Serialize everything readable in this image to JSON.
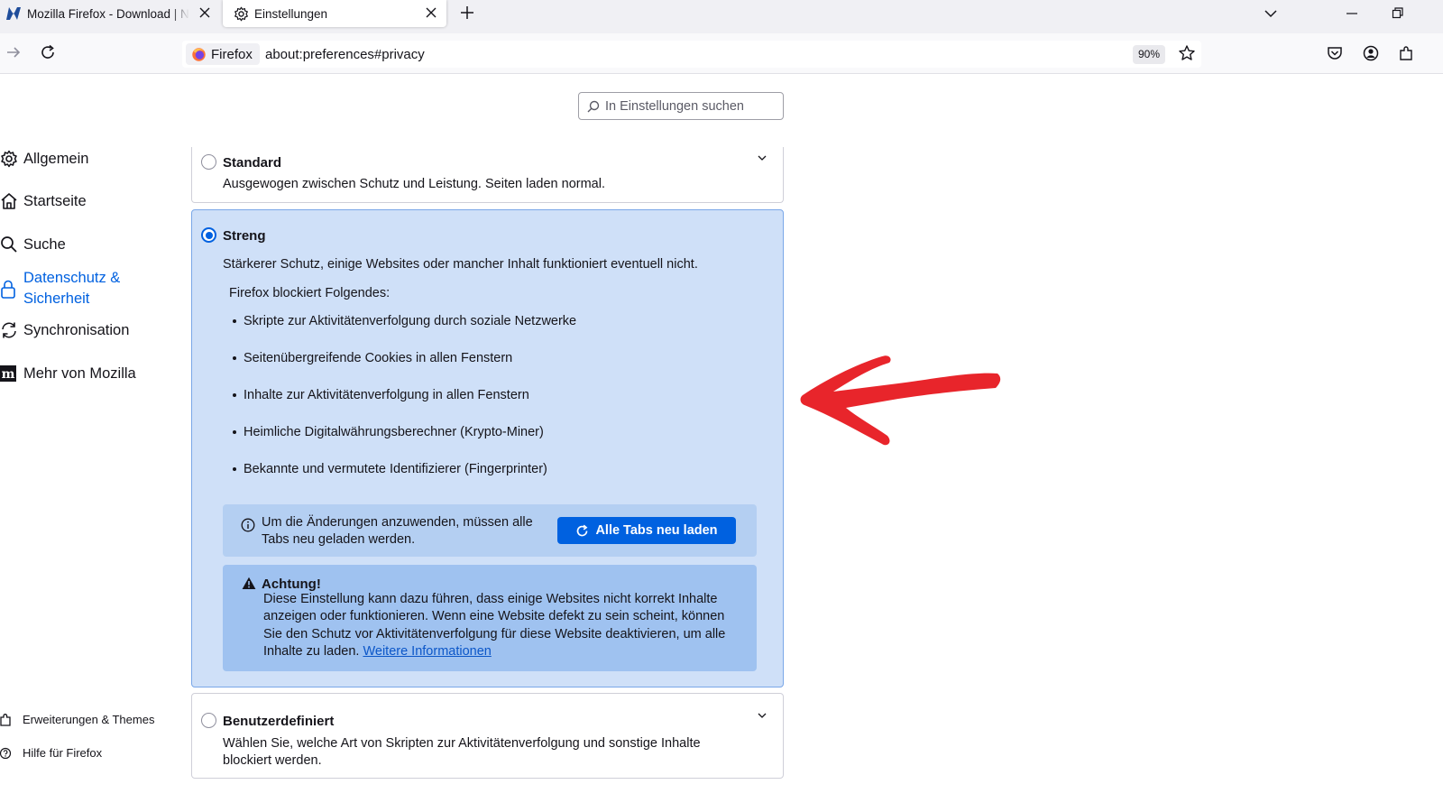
{
  "tabs": [
    {
      "title": "Mozilla Firefox - Download | NETZWELT",
      "icon": "netzwelt-icon"
    },
    {
      "title": "Einstellungen",
      "icon": "gear-icon"
    }
  ],
  "navbar": {
    "identity_label": "Firefox",
    "url": "about:preferences#privacy",
    "zoom": "90%"
  },
  "search": {
    "placeholder": "In Einstellungen suchen"
  },
  "sidebar": {
    "items": [
      {
        "label": "Allgemein",
        "icon": "gear-icon"
      },
      {
        "label": "Startseite",
        "icon": "home-icon"
      },
      {
        "label": "Suche",
        "icon": "search-icon"
      },
      {
        "label_line1": "Datenschutz &",
        "label_line2": "Sicherheit",
        "icon": "lock-icon",
        "selected": true
      },
      {
        "label": "Synchronisation",
        "icon": "sync-icon"
      },
      {
        "label": "Mehr von Mozilla",
        "icon": "mozilla-icon"
      }
    ],
    "footer": [
      {
        "label": "Erweiterungen & Themes",
        "icon": "puzzle-icon"
      },
      {
        "label": "Hilfe für Firefox",
        "icon": "help-icon"
      }
    ]
  },
  "protection": {
    "standard": {
      "label": "Standard",
      "description": "Ausgewogen zwischen Schutz und Leistung. Seiten laden normal."
    },
    "strict": {
      "label": "Streng",
      "description": "Stärkerer Schutz, einige Websites oder mancher Inhalt funktioniert eventuell nicht.",
      "blocks_title": "Firefox blockiert Folgendes:",
      "blocks": [
        "Skripte zur Aktivitätenverfolgung durch soziale Netzwerke",
        "Seitenübergreifende Cookies in allen Fenstern",
        "Inhalte zur Aktivitätenverfolgung in allen Fenstern",
        "Heimliche Digitalwährungsberechner (Krypto-Miner)",
        "Bekannte und vermutete Identifizierer (Fingerprinter)"
      ],
      "reload_message": "Um die Änderungen anzuwenden, müssen alle Tabs neu geladen werden.",
      "reload_button": "Alle Tabs neu laden",
      "warning_title": "Achtung!",
      "warning_text": "Diese Einstellung kann dazu führen, dass einige Websites nicht korrekt Inhalte anzeigen oder funktionieren. Wenn eine Website defekt zu sein scheint, können Sie den Schutz vor Aktivitätenverfolgung für diese Website deaktivieren, um alle Inhalte zu laden.",
      "warning_link": "Weitere Informationen"
    },
    "custom": {
      "label": "Benutzerdefiniert",
      "description": "Wählen Sie, welche Art von Skripten zur Aktivitätenverfolgung und sonstige Inhalte blockiert werden."
    }
  },
  "colors": {
    "accent": "#0061e0",
    "strict_bg": "#cfe0f8",
    "annotation_arrow": "#e8252b"
  }
}
